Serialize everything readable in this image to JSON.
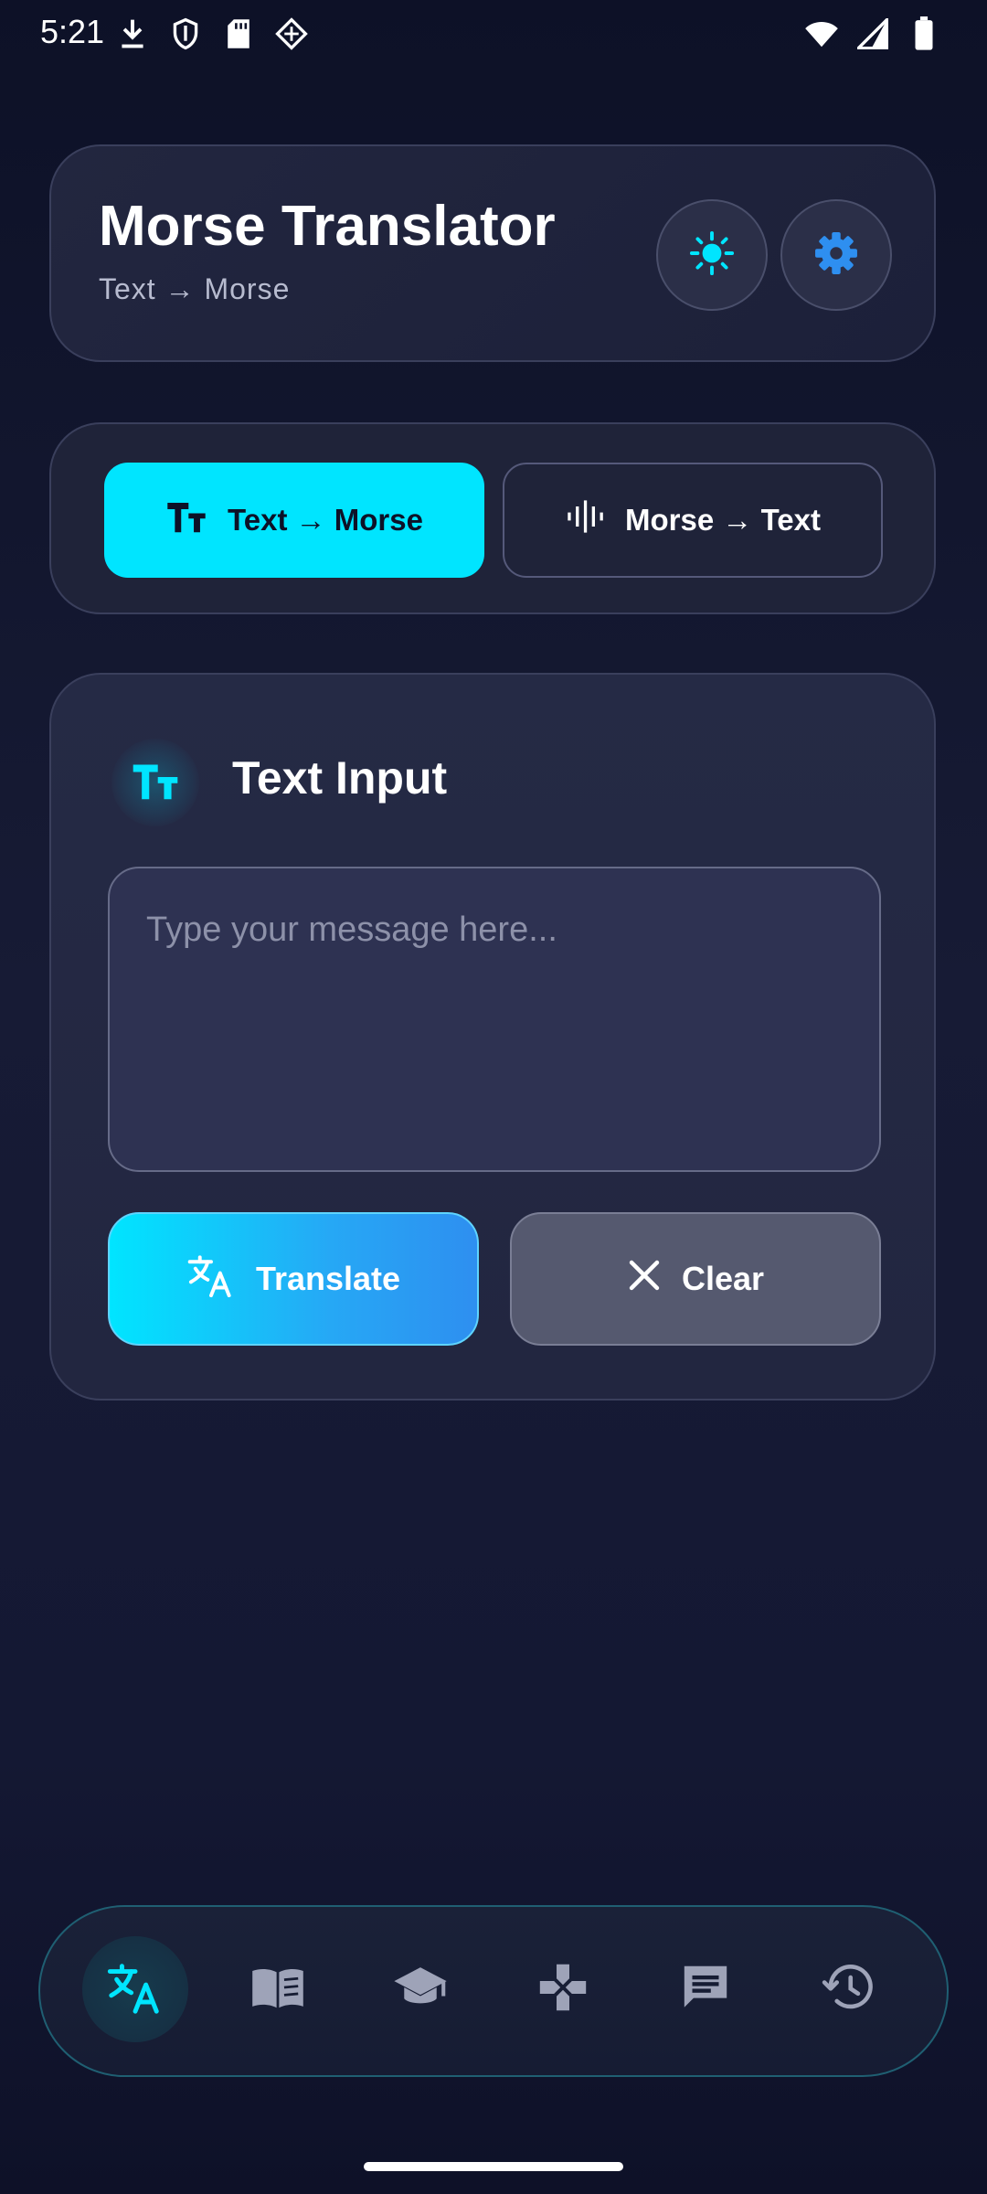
{
  "status_bar": {
    "time": "5:21"
  },
  "header": {
    "title": "Morse Translator",
    "subtitle": "Text → Morse"
  },
  "mode": {
    "text_to_morse_label": "Text → Morse",
    "morse_to_text_label": "Morse → Text",
    "active": "text_to_morse"
  },
  "input_section": {
    "title": "Text Input",
    "placeholder": "Type your message here...",
    "value": ""
  },
  "actions": {
    "translate_label": "Translate",
    "clear_label": "Clear"
  },
  "bottom_nav": {
    "active": "translate",
    "items": [
      "translate",
      "reference",
      "learn",
      "game",
      "chat",
      "history"
    ]
  },
  "colors": {
    "accent": "#00e5ff",
    "accent_blue": "#2e8ff0",
    "background": "#141833",
    "card": "#22263f"
  }
}
